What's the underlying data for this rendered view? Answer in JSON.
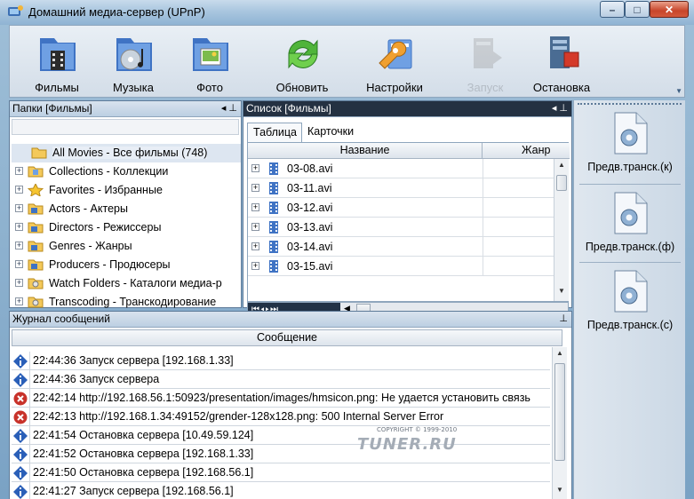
{
  "window": {
    "title": "Домашний медиа-сервер (UPnP)",
    "min": "–",
    "max": "□",
    "close": "✕"
  },
  "toolbar": {
    "items": [
      {
        "label": "Фильмы",
        "icon": "films-folder-icon",
        "disabled": false
      },
      {
        "label": "Музыка",
        "icon": "music-folder-icon",
        "disabled": false
      },
      {
        "label": "Фото",
        "icon": "photo-folder-icon",
        "disabled": false
      },
      {
        "label": "Обновить",
        "icon": "refresh-icon",
        "disabled": false
      },
      {
        "label": "Настройки",
        "icon": "settings-icon",
        "disabled": false
      },
      {
        "label": "Запуск",
        "icon": "start-icon",
        "disabled": true
      },
      {
        "label": "Остановка",
        "icon": "stop-icon",
        "disabled": false
      }
    ]
  },
  "folders_panel": {
    "title": "Папки [Фильмы]",
    "pin": "◂ ⊥",
    "items": [
      {
        "label": "All Movies - Все фильмы (748)",
        "selected": true
      },
      {
        "label": "Collections - Коллекции"
      },
      {
        "label": "Favorites - Избранные"
      },
      {
        "label": "Actors - Актеры"
      },
      {
        "label": "Directors - Режиссеры"
      },
      {
        "label": "Genres - Жанры"
      },
      {
        "label": "Producers - Продюсеры"
      },
      {
        "label": "Watch Folders - Каталоги медиа-р"
      },
      {
        "label": "Transcoding - Транскодирование"
      }
    ]
  },
  "list_panel": {
    "title": "Список [Фильмы]",
    "pin": "◂ ⊥",
    "tabs": [
      "Таблица",
      "Карточки"
    ],
    "columns": [
      "Название",
      "Жанр"
    ],
    "rows": [
      "03-08.avi",
      "03-11.avi",
      "03-12.avi",
      "03-13.avi",
      "03-14.avi",
      "03-15.avi"
    ],
    "nav": "⏮◂▸⏭"
  },
  "sidebar": {
    "items": [
      "Предв.транск.(к)",
      "Предв.транск.(ф)",
      "Предв.транск.(с)"
    ]
  },
  "log_panel": {
    "title": "Журнал сообщений",
    "pin": "⊥",
    "column": "Сообщение",
    "rows": [
      {
        "type": "info",
        "text": "22:44:36 Запуск сервера [192.168.1.33]"
      },
      {
        "type": "info",
        "text": "22:44:36 Запуск сервера"
      },
      {
        "type": "error",
        "text": "22:42:14 http://192.168.56.1:50923/presentation/images/hmsicon.png: Не удается установить связь"
      },
      {
        "type": "error",
        "text": "22:42:13 http://192.168.1.34:49152/grender-128x128.png: 500 Internal Server Error"
      },
      {
        "type": "info",
        "text": "22:41:54 Остановка сервера [10.49.59.124]"
      },
      {
        "type": "info",
        "text": "22:41:52 Остановка сервера [192.168.1.33]"
      },
      {
        "type": "info",
        "text": "22:41:50 Остановка сервера [192.168.56.1]"
      },
      {
        "type": "info",
        "text": "22:41:27 Запуск сервера [192.168.56.1]"
      }
    ]
  },
  "watermark": {
    "copyright": "COPYRIGHT © 1999-2010",
    "logo": "TUNER.RU"
  },
  "colors": {
    "info": "#2a5fb8",
    "error": "#c8322a",
    "accent": "#243142"
  }
}
